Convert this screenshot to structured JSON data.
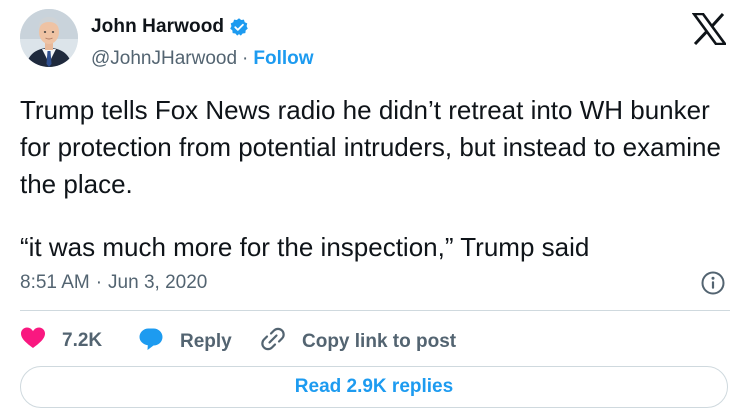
{
  "author": {
    "name": "John Harwood",
    "handle": "@JohnJHarwood",
    "separator": "·",
    "follow_label": "Follow",
    "verified": true
  },
  "tweet": {
    "paragraph1": "Trump tells Fox News radio he didn’t retreat into WH bunker for protection from potential intruders, but instead to examine the place.",
    "paragraph2": "“it was much more for the inspection,” Trump said"
  },
  "meta": {
    "time": "8:51 AM",
    "separator": "·",
    "date": "Jun 3, 2020"
  },
  "actions": {
    "like_count": "7.2K",
    "reply_label": "Reply",
    "copy_link_label": "Copy link to post",
    "read_replies_label": "Read 2.9K replies"
  },
  "colors": {
    "accent": "#1d9bf0",
    "like": "#f91880",
    "text": "#0f1419",
    "secondary": "#536471",
    "border": "#cfd9de"
  },
  "icons": [
    "verified-badge-icon",
    "x-logo-icon",
    "info-icon",
    "heart-icon",
    "reply-bubble-icon",
    "link-icon"
  ]
}
